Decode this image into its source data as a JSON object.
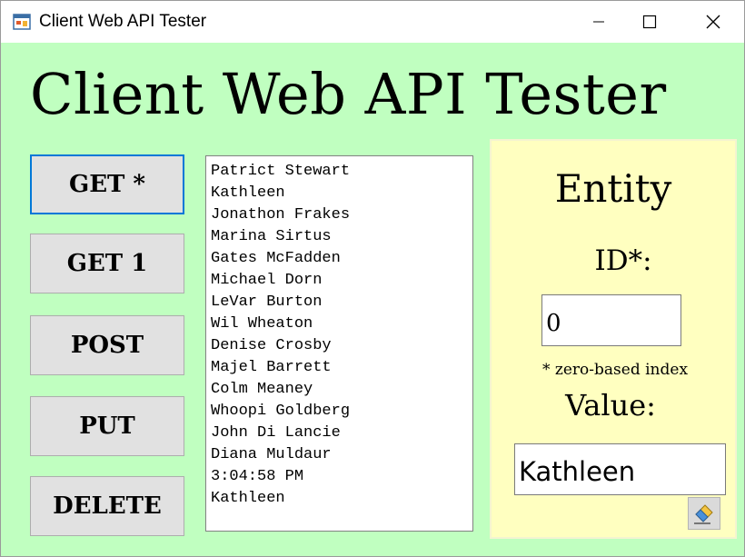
{
  "window": {
    "title": "Client Web API Tester"
  },
  "heading": "Client Web API Tester",
  "buttons": {
    "get_all": "GET *",
    "get_one": "GET 1",
    "post": "POST",
    "put": "PUT",
    "delete": "DELETE"
  },
  "list": {
    "items": [
      "Patrict Stewart",
      "Kathleen",
      "Jonathon Frakes",
      "Marina Sirtus",
      "Gates McFadden",
      "Michael Dorn",
      "LeVar Burton",
      "Wil Wheaton",
      "Denise Crosby",
      "Majel Barrett",
      "Colm Meaney",
      "Whoopi Goldberg",
      "John Di Lancie",
      "Diana Muldaur",
      "3:04:58 PM",
      "Kathleen"
    ]
  },
  "entity": {
    "title": "Entity",
    "id_label": "ID*:",
    "id_value": "0",
    "hint": "* zero-based index",
    "value_label": "Value:",
    "value_value": "Kathleen",
    "clear_icon": "eraser-icon"
  },
  "colors": {
    "window_bg": "#c0ffc0",
    "panel_bg": "#ffffc0",
    "focus_border": "#0078d7",
    "button_bg": "#e1e1e1"
  }
}
